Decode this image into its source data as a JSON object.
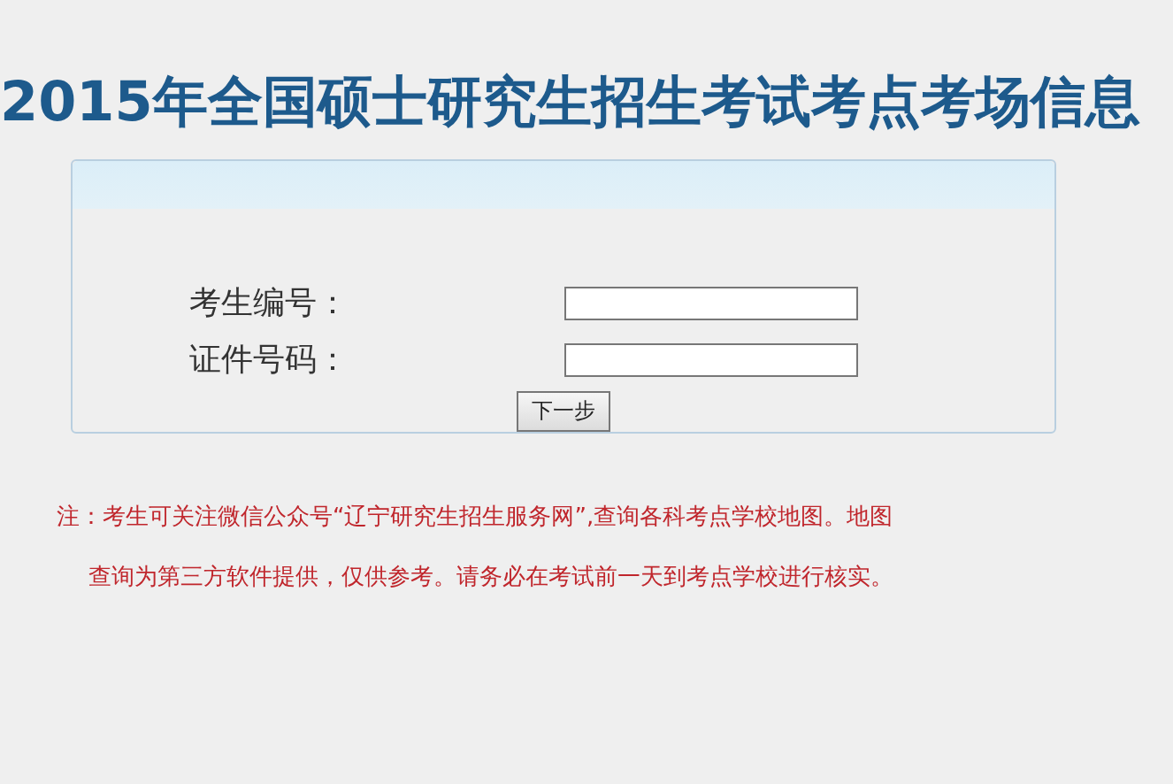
{
  "title": "2015年全国硕士研究生招生考试考点考场信息",
  "form": {
    "fields": [
      {
        "label": "考生编号："
      },
      {
        "label": "证件号码："
      }
    ],
    "button": "下一步"
  },
  "notes": [
    "注：考生可关注微信公众号“辽宁研究生招生服务网”,查询各科考点学校地图。地图",
    "查询为第三方软件提供，仅供参考。请务必在考试前一天到考点学校进行核实。"
  ]
}
